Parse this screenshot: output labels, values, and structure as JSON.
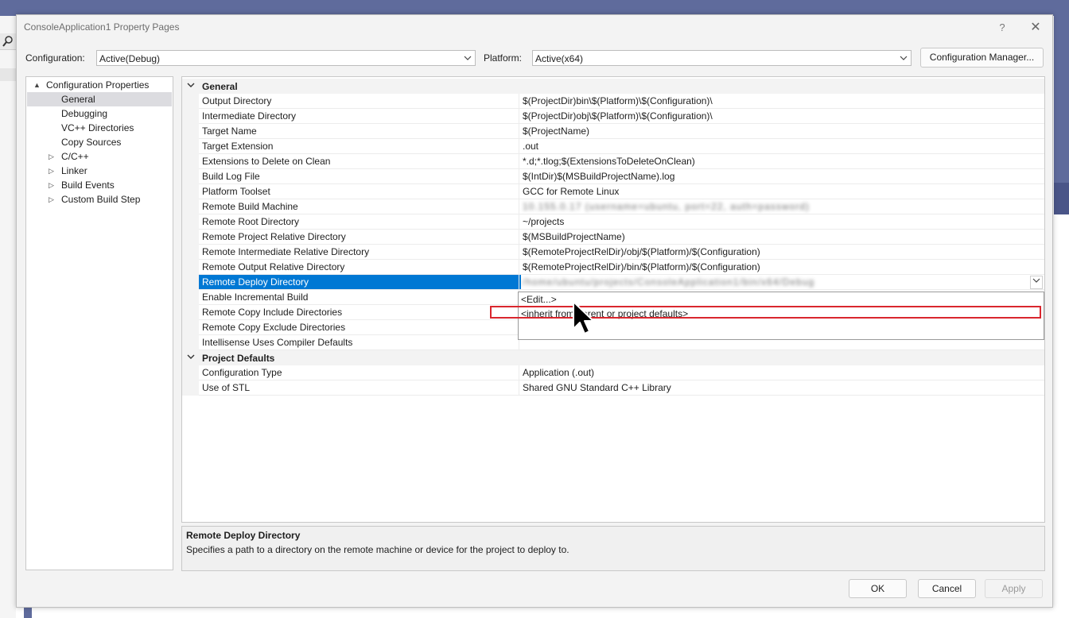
{
  "dialog": {
    "title": "ConsoleApplication1 Property Pages",
    "help_label": "?",
    "close_label": "✕"
  },
  "config_bar": {
    "configuration_label": "Configuration:",
    "configuration_value": "Active(Debug)",
    "platform_label": "Platform:",
    "platform_value": "Active(x64)",
    "manager_button": "Configuration Manager..."
  },
  "tree": {
    "items": [
      {
        "label": "Configuration Properties",
        "expander": "▲"
      },
      {
        "label": "General",
        "selected": true
      },
      {
        "label": "Debugging"
      },
      {
        "label": "VC++ Directories"
      },
      {
        "label": "Copy Sources"
      },
      {
        "label": "C/C++",
        "expander": "▷"
      },
      {
        "label": "Linker",
        "expander": "▷"
      },
      {
        "label": "Build Events",
        "expander": "▷"
      },
      {
        "label": "Custom Build Step",
        "expander": "▷"
      }
    ]
  },
  "grid": {
    "general_label": "General",
    "defaults_label": "Project Defaults",
    "general_rows": [
      {
        "name": "Output Directory",
        "value": "$(ProjectDir)bin\\$(Platform)\\$(Configuration)\\"
      },
      {
        "name": "Intermediate Directory",
        "value": "$(ProjectDir)obj\\$(Platform)\\$(Configuration)\\"
      },
      {
        "name": "Target Name",
        "value": "$(ProjectName)"
      },
      {
        "name": "Target Extension",
        "value": ".out"
      },
      {
        "name": "Extensions to Delete on Clean",
        "value": "*.d;*.tlog;$(ExtensionsToDeleteOnClean)"
      },
      {
        "name": "Build Log File",
        "value": "$(IntDir)$(MSBuildProjectName).log"
      },
      {
        "name": "Platform Toolset",
        "value": "GCC for Remote Linux"
      },
      {
        "name": "Remote Build Machine",
        "value": "10.155.0.17 (username=ubuntu, port=22, auth=password)"
      },
      {
        "name": "Remote Root Directory",
        "value": "~/projects"
      },
      {
        "name": "Remote Project Relative Directory",
        "value": "$(MSBuildProjectName)"
      },
      {
        "name": "Remote Intermediate Relative Directory",
        "value": "$(RemoteProjectRelDir)/obj/$(Platform)/$(Configuration)"
      },
      {
        "name": "Remote Output Relative Directory",
        "value": "$(RemoteProjectRelDir)/bin/$(Platform)/$(Configuration)"
      },
      {
        "name": "Remote Deploy Directory",
        "value": "/home/ubuntu/projects/ConsoleApplication1/bin/x64/Debug"
      },
      {
        "name": "Enable Incremental Build",
        "value": ""
      },
      {
        "name": "Remote Copy Include Directories",
        "value": ""
      },
      {
        "name": "Remote Copy Exclude Directories",
        "value": ""
      },
      {
        "name": "Intellisense Uses Compiler Defaults",
        "value": ""
      }
    ],
    "defaults_rows": [
      {
        "name": "Configuration Type",
        "value": "Application (.out)"
      },
      {
        "name": "Use of STL",
        "value": "Shared GNU Standard C++ Library"
      }
    ]
  },
  "popup": {
    "items": [
      "<Edit...>",
      "<inherit from parent or project defaults>"
    ]
  },
  "description": {
    "title": "Remote Deploy Directory",
    "text": "Specifies a path to a directory on the remote machine or device for the project to deploy to."
  },
  "buttons": {
    "ok": "OK",
    "cancel": "Cancel",
    "apply": "Apply"
  },
  "colors": {
    "selection": "#0078d4",
    "highlight_box": "#d9262e"
  }
}
